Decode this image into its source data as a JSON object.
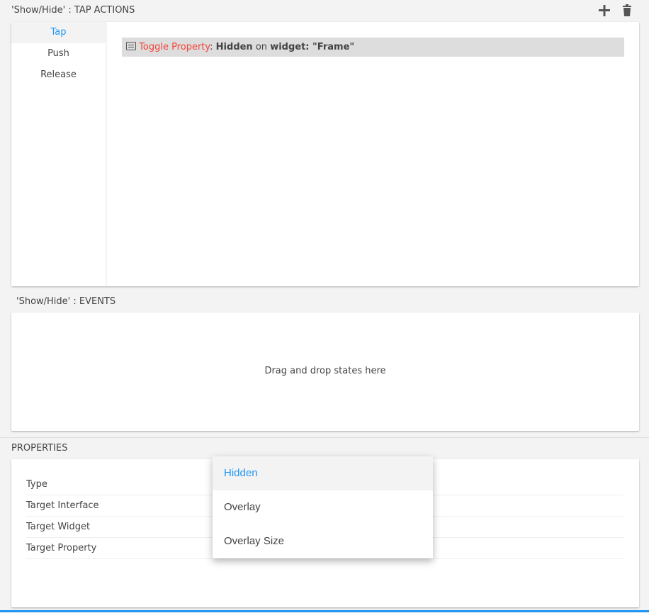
{
  "tap_actions": {
    "title": "'Show/Hide' : TAP ACTIONS",
    "tabs": [
      "Tap",
      "Push",
      "Release"
    ],
    "action": {
      "type": "Toggle Property",
      "sep": ":",
      "property": "Hidden",
      "on": "on",
      "target": "widget: \"Frame\""
    }
  },
  "events": {
    "title": "'Show/Hide' : EVENTS",
    "placeholder": "Drag and drop states here"
  },
  "properties": {
    "title": "PROPERTIES",
    "rows": [
      "Type",
      "Target Interface",
      "Target Widget",
      "Target Property"
    ]
  },
  "dropdown": {
    "options": [
      "Hidden",
      "Overlay",
      "Overlay Size"
    ],
    "selected": "Hidden"
  },
  "colors": {
    "accent": "#2196f3",
    "action": "#f44336"
  }
}
